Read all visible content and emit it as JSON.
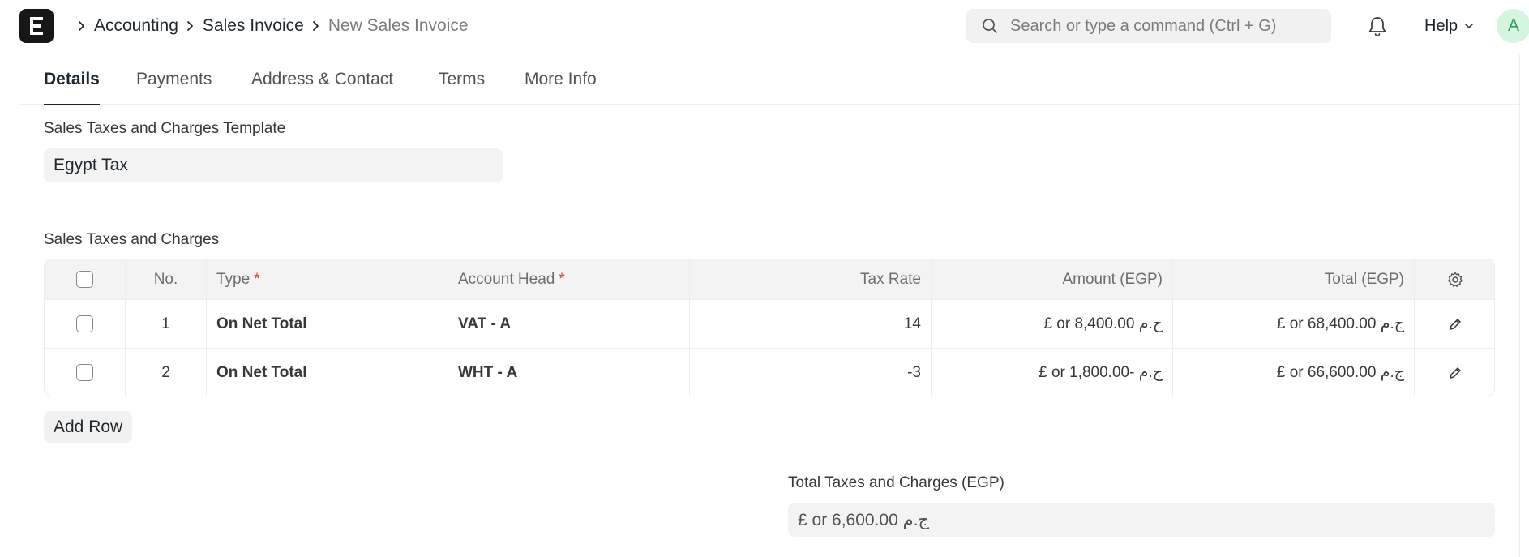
{
  "breadcrumbs": {
    "items": [
      "Accounting",
      "Sales Invoice"
    ],
    "current": "New Sales Invoice"
  },
  "search": {
    "placeholder": "Search or type a command (Ctrl + G)"
  },
  "help": {
    "label": "Help"
  },
  "avatar": {
    "initial": "A"
  },
  "tabs": [
    {
      "label": "Details",
      "active": true
    },
    {
      "label": "Payments"
    },
    {
      "label": "Address & Contact"
    },
    {
      "label": "Terms"
    },
    {
      "label": "More Info"
    }
  ],
  "template": {
    "label": "Sales Taxes and Charges Template",
    "value": "Egypt Tax"
  },
  "taxes": {
    "label": "Sales Taxes and Charges",
    "columns": {
      "no": "No.",
      "type": "Type",
      "account": "Account Head",
      "rate": "Tax Rate",
      "amount": "Amount (EGP)",
      "total": "Total (EGP)"
    },
    "rows": [
      {
        "no": "1",
        "type": "On Net Total",
        "account": "VAT - A",
        "rate": "14",
        "amount": "£ or 8,400.00 ج.م",
        "total": "£ or 68,400.00 ج.م"
      },
      {
        "no": "2",
        "type": "On Net Total",
        "account": "WHT - A",
        "rate": "-3",
        "amount": "£ or 1,800.00- ج.م",
        "total": "£ or 66,600.00 ج.م"
      }
    ],
    "add_row": "Add Row"
  },
  "total_taxes": {
    "label": "Total Taxes and Charges (EGP)",
    "value": "£ or 6,600.00 ج.م"
  },
  "colors": {
    "accent": "#171717",
    "required": "#e03636",
    "avatar_bg": "#d6f5de",
    "avatar_fg": "#2f9e5b"
  },
  "icons": [
    "app-logo-icon",
    "chevron-right-icon",
    "search-icon",
    "bell-icon",
    "chevron-down-icon",
    "gear-icon",
    "pencil-icon"
  ]
}
